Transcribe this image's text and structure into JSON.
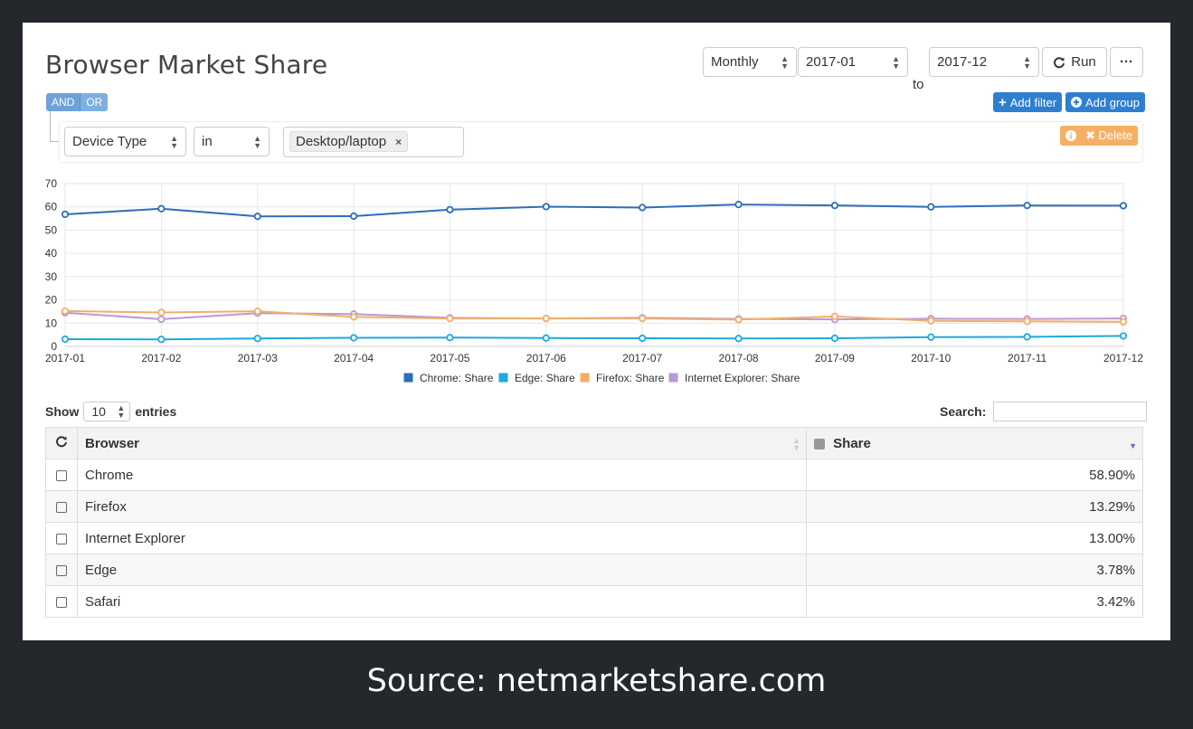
{
  "header": {
    "title": "Browser Market Share",
    "period": "Monthly",
    "from": "2017-01",
    "to_label": "to",
    "to": "2017-12",
    "run_label": "Run",
    "more_label": "···"
  },
  "filter": {
    "and_label": "AND",
    "or_label": "OR",
    "add_filter_label": "Add filter",
    "add_group_label": "Add group",
    "field": "Device Type",
    "operator": "in",
    "value_tag": "Desktop/laptop",
    "tag_remove": "×",
    "delete_label": "Delete"
  },
  "chart_data": {
    "type": "line",
    "x": [
      "2017-01",
      "2017-02",
      "2017-03",
      "2017-04",
      "2017-05",
      "2017-06",
      "2017-07",
      "2017-08",
      "2017-09",
      "2017-10",
      "2017-11",
      "2017-12"
    ],
    "y_ticks": [
      0,
      10,
      20,
      30,
      40,
      50,
      60,
      70
    ],
    "ylim": [
      0,
      70
    ],
    "grid": true,
    "legend_position": "bottom",
    "series": [
      {
        "name": "Chrome: Share",
        "color": "#2e6eb8",
        "values": [
          56.8,
          59.2,
          55.9,
          56.0,
          58.8,
          60.1,
          59.7,
          61.0,
          60.6,
          60.0,
          60.6,
          60.5
        ]
      },
      {
        "name": "Edge: Share",
        "color": "#1fa8e0",
        "values": [
          3.1,
          3.0,
          3.4,
          3.7,
          3.8,
          3.6,
          3.5,
          3.4,
          3.5,
          4.0,
          4.1,
          4.5
        ]
      },
      {
        "name": "Firefox: Share",
        "color": "#f2ad6a",
        "values": [
          15.2,
          14.6,
          15.1,
          12.7,
          12.0,
          12.0,
          12.0,
          11.5,
          12.9,
          11.0,
          10.8,
          10.6
        ]
      },
      {
        "name": "Internet Explorer: Share",
        "color": "#b99ad2",
        "values": [
          14.5,
          11.7,
          14.3,
          13.9,
          12.3,
          12.0,
          12.3,
          11.8,
          11.6,
          11.9,
          11.8,
          12.0
        ]
      }
    ]
  },
  "table": {
    "show_label": "Show",
    "entries_value": "10",
    "entries_label": "entries",
    "search_label": "Search:",
    "columns": [
      "Browser",
      "Share"
    ],
    "rows": [
      {
        "browser": "Chrome",
        "share": "58.90%"
      },
      {
        "browser": "Firefox",
        "share": "13.29%"
      },
      {
        "browser": "Internet Explorer",
        "share": "13.00%"
      },
      {
        "browser": "Edge",
        "share": "3.78%"
      },
      {
        "browser": "Safari",
        "share": "3.42%"
      }
    ]
  },
  "source": "Source: netmarketshare.com"
}
